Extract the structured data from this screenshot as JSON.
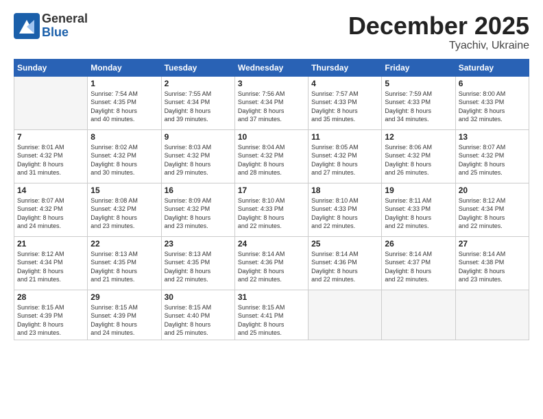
{
  "logo": {
    "general": "General",
    "blue": "Blue"
  },
  "header": {
    "month": "December 2025",
    "location": "Tyachiv, Ukraine"
  },
  "weekdays": [
    "Sunday",
    "Monday",
    "Tuesday",
    "Wednesday",
    "Thursday",
    "Friday",
    "Saturday"
  ],
  "weeks": [
    [
      {
        "day": "",
        "info": ""
      },
      {
        "day": "1",
        "info": "Sunrise: 7:54 AM\nSunset: 4:35 PM\nDaylight: 8 hours\nand 40 minutes."
      },
      {
        "day": "2",
        "info": "Sunrise: 7:55 AM\nSunset: 4:34 PM\nDaylight: 8 hours\nand 39 minutes."
      },
      {
        "day": "3",
        "info": "Sunrise: 7:56 AM\nSunset: 4:34 PM\nDaylight: 8 hours\nand 37 minutes."
      },
      {
        "day": "4",
        "info": "Sunrise: 7:57 AM\nSunset: 4:33 PM\nDaylight: 8 hours\nand 35 minutes."
      },
      {
        "day": "5",
        "info": "Sunrise: 7:59 AM\nSunset: 4:33 PM\nDaylight: 8 hours\nand 34 minutes."
      },
      {
        "day": "6",
        "info": "Sunrise: 8:00 AM\nSunset: 4:33 PM\nDaylight: 8 hours\nand 32 minutes."
      }
    ],
    [
      {
        "day": "7",
        "info": "Sunrise: 8:01 AM\nSunset: 4:32 PM\nDaylight: 8 hours\nand 31 minutes."
      },
      {
        "day": "8",
        "info": "Sunrise: 8:02 AM\nSunset: 4:32 PM\nDaylight: 8 hours\nand 30 minutes."
      },
      {
        "day": "9",
        "info": "Sunrise: 8:03 AM\nSunset: 4:32 PM\nDaylight: 8 hours\nand 29 minutes."
      },
      {
        "day": "10",
        "info": "Sunrise: 8:04 AM\nSunset: 4:32 PM\nDaylight: 8 hours\nand 28 minutes."
      },
      {
        "day": "11",
        "info": "Sunrise: 8:05 AM\nSunset: 4:32 PM\nDaylight: 8 hours\nand 27 minutes."
      },
      {
        "day": "12",
        "info": "Sunrise: 8:06 AM\nSunset: 4:32 PM\nDaylight: 8 hours\nand 26 minutes."
      },
      {
        "day": "13",
        "info": "Sunrise: 8:07 AM\nSunset: 4:32 PM\nDaylight: 8 hours\nand 25 minutes."
      }
    ],
    [
      {
        "day": "14",
        "info": "Sunrise: 8:07 AM\nSunset: 4:32 PM\nDaylight: 8 hours\nand 24 minutes."
      },
      {
        "day": "15",
        "info": "Sunrise: 8:08 AM\nSunset: 4:32 PM\nDaylight: 8 hours\nand 23 minutes."
      },
      {
        "day": "16",
        "info": "Sunrise: 8:09 AM\nSunset: 4:32 PM\nDaylight: 8 hours\nand 23 minutes."
      },
      {
        "day": "17",
        "info": "Sunrise: 8:10 AM\nSunset: 4:33 PM\nDaylight: 8 hours\nand 22 minutes."
      },
      {
        "day": "18",
        "info": "Sunrise: 8:10 AM\nSunset: 4:33 PM\nDaylight: 8 hours\nand 22 minutes."
      },
      {
        "day": "19",
        "info": "Sunrise: 8:11 AM\nSunset: 4:33 PM\nDaylight: 8 hours\nand 22 minutes."
      },
      {
        "day": "20",
        "info": "Sunrise: 8:12 AM\nSunset: 4:34 PM\nDaylight: 8 hours\nand 22 minutes."
      }
    ],
    [
      {
        "day": "21",
        "info": "Sunrise: 8:12 AM\nSunset: 4:34 PM\nDaylight: 8 hours\nand 21 minutes."
      },
      {
        "day": "22",
        "info": "Sunrise: 8:13 AM\nSunset: 4:35 PM\nDaylight: 8 hours\nand 21 minutes."
      },
      {
        "day": "23",
        "info": "Sunrise: 8:13 AM\nSunset: 4:35 PM\nDaylight: 8 hours\nand 22 minutes."
      },
      {
        "day": "24",
        "info": "Sunrise: 8:14 AM\nSunset: 4:36 PM\nDaylight: 8 hours\nand 22 minutes."
      },
      {
        "day": "25",
        "info": "Sunrise: 8:14 AM\nSunset: 4:36 PM\nDaylight: 8 hours\nand 22 minutes."
      },
      {
        "day": "26",
        "info": "Sunrise: 8:14 AM\nSunset: 4:37 PM\nDaylight: 8 hours\nand 22 minutes."
      },
      {
        "day": "27",
        "info": "Sunrise: 8:14 AM\nSunset: 4:38 PM\nDaylight: 8 hours\nand 23 minutes."
      }
    ],
    [
      {
        "day": "28",
        "info": "Sunrise: 8:15 AM\nSunset: 4:39 PM\nDaylight: 8 hours\nand 23 minutes."
      },
      {
        "day": "29",
        "info": "Sunrise: 8:15 AM\nSunset: 4:39 PM\nDaylight: 8 hours\nand 24 minutes."
      },
      {
        "day": "30",
        "info": "Sunrise: 8:15 AM\nSunset: 4:40 PM\nDaylight: 8 hours\nand 25 minutes."
      },
      {
        "day": "31",
        "info": "Sunrise: 8:15 AM\nSunset: 4:41 PM\nDaylight: 8 hours\nand 25 minutes."
      },
      {
        "day": "",
        "info": ""
      },
      {
        "day": "",
        "info": ""
      },
      {
        "day": "",
        "info": ""
      }
    ]
  ]
}
